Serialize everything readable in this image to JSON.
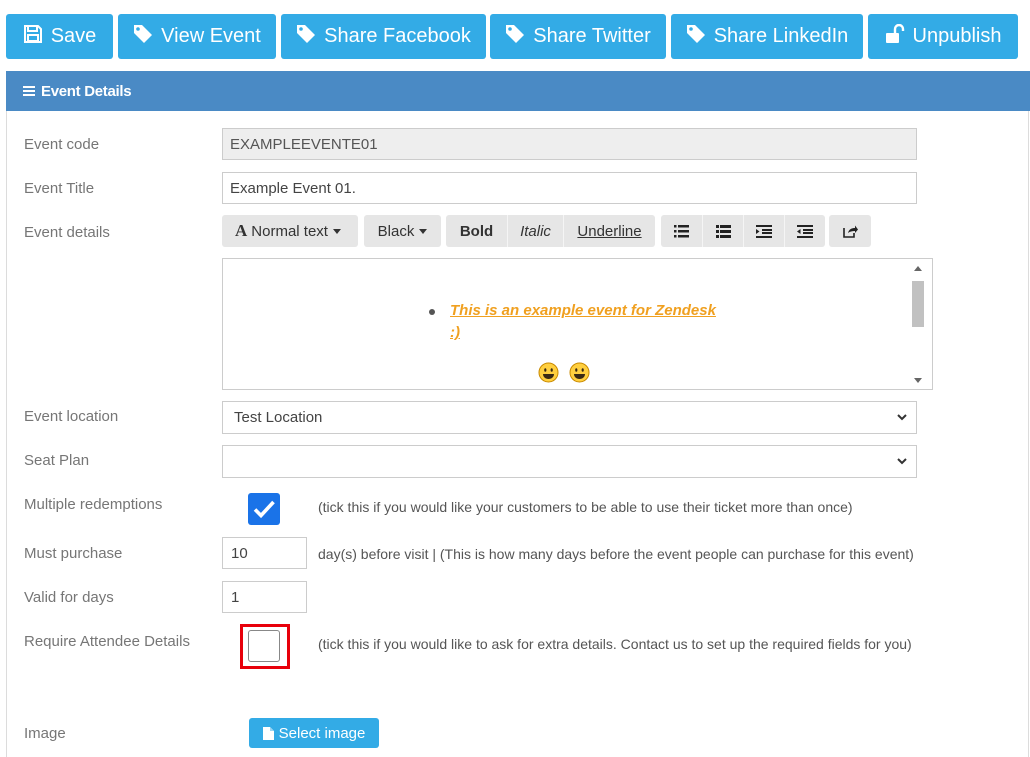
{
  "toolbar": {
    "save": "Save",
    "view_event": "View Event",
    "share_facebook": "Share Facebook",
    "share_twitter": "Share Twitter",
    "share_linkedin": "Share LinkedIn",
    "unpublish": "Unpublish"
  },
  "panel": {
    "title": "Event Details"
  },
  "form": {
    "event_code": {
      "label": "Event code",
      "value": "EXAMPLEEVENTE01"
    },
    "event_title": {
      "label": "Event Title",
      "value": "Example Event 01."
    },
    "event_details": {
      "label": "Event details",
      "toolbar": {
        "text_style": "Normal text",
        "color": "Black",
        "bold": "Bold",
        "italic": "Italic",
        "underline": "Underline"
      },
      "content": {
        "list_line1": "This is an example event for Zendesk",
        "list_line2": ":)"
      }
    },
    "event_location": {
      "label": "Event location",
      "value": "Test Location"
    },
    "seat_plan": {
      "label": "Seat Plan",
      "value": ""
    },
    "multiple_redemptions": {
      "label": "Multiple redemptions",
      "checked": true,
      "note": "(tick this if you would like your customers to be able to use their ticket more than once)"
    },
    "must_purchase": {
      "label": "Must purchase",
      "value": "10",
      "note": "day(s) before visit | (This is how many days before the event people can purchase for this event)"
    },
    "valid_for_days": {
      "label": "Valid for days",
      "value": "1"
    },
    "require_attendee_details": {
      "label": "Require Attendee Details",
      "checked": false,
      "note": "(tick this if you would like to ask for extra details. Contact us to set up the required fields for you)"
    },
    "image": {
      "label": "Image",
      "button": "Select image"
    }
  },
  "colors": {
    "button": "#33abe6",
    "panel_header": "#4a8ac5",
    "checkbox": "#1a73e8",
    "highlight": "#e8000b",
    "editor_text": "#f0a020"
  }
}
